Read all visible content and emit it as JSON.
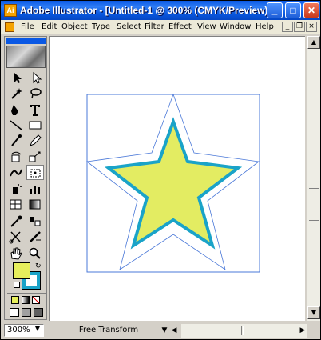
{
  "window": {
    "title": "Adobe Illustrator - [Untitled-1 @ 300% (CMYK/Preview) ]",
    "app_icon": "illustrator-icon",
    "controls": {
      "minimize": "_",
      "maximize": "□",
      "close": "✕"
    }
  },
  "menubar": {
    "items": [
      "File",
      "Edit",
      "Object",
      "Type",
      "Select",
      "Filter",
      "Effect",
      "View",
      "Window",
      "Help"
    ],
    "doc_controls": {
      "minimize": "_",
      "restore": "❐",
      "close": "×"
    }
  },
  "toolbox": {
    "tools": [
      "selection-tool-icon",
      "direct-selection-tool-icon",
      "magic-wand-tool-icon",
      "lasso-tool-icon",
      "pen-tool-icon",
      "type-tool-icon",
      "line-tool-icon",
      "rectangle-tool-icon",
      "paintbrush-tool-icon",
      "pencil-tool-icon",
      "rotate-tool-icon",
      "scale-tool-icon",
      "warp-tool-icon",
      "free-transform-tool-icon",
      "symbol-sprayer-tool-icon",
      "column-graph-tool-icon",
      "mesh-tool-icon",
      "gradient-tool-icon",
      "eyedropper-tool-icon",
      "blend-tool-icon",
      "scissors-tool-icon",
      "slice-tool-icon",
      "hand-tool-icon",
      "zoom-tool-icon"
    ],
    "fill_color": "#e6ef5c",
    "stroke_color": "#1aa3c8"
  },
  "canvas": {
    "artboard_stroke": "#4a78d8",
    "star_fill": "#e3ec62",
    "star_stroke": "#1aa3c8",
    "outline_color": "#4a78d8"
  },
  "status": {
    "zoom": "300%",
    "tool_label": "Free Transform"
  }
}
